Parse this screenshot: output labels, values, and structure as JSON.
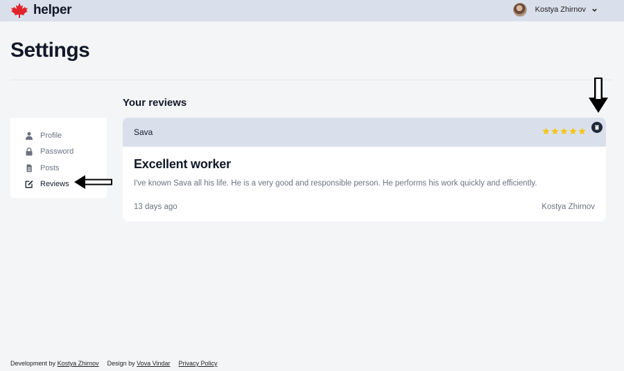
{
  "brand": {
    "name": "helper",
    "logo_icon": "maple-leaf-icon",
    "logo_color": "#e0242b"
  },
  "user": {
    "name": "Kostya Zhirnov"
  },
  "page": {
    "title": "Settings"
  },
  "sidebar": {
    "items": [
      {
        "label": "Profile",
        "icon": "user-icon"
      },
      {
        "label": "Password",
        "icon": "lock-icon"
      },
      {
        "label": "Posts",
        "icon": "document-icon"
      },
      {
        "label": "Reviews",
        "icon": "edit-icon",
        "active": true
      }
    ]
  },
  "reviews": {
    "section_title": "Your reviews",
    "items": [
      {
        "reviewee": "Sava",
        "rating": 5,
        "title": "Excellent worker",
        "text": "I've known Sava all his life. He is a very good and responsible person. He performs his work quickly and efficiently.",
        "date": "13 days ago",
        "author": "Kostya Zhirnov"
      }
    ]
  },
  "footer": {
    "dev_prefix": "Development by",
    "dev_name": "Kostya Zhirnov",
    "design_prefix": "Design by",
    "design_name": "Vova Vindar",
    "privacy": "Privacy Policy"
  },
  "colors": {
    "header_bg": "#d9e0ec",
    "star": "#f5c518",
    "text_dark": "#111827",
    "text_muted": "#6b7280"
  }
}
